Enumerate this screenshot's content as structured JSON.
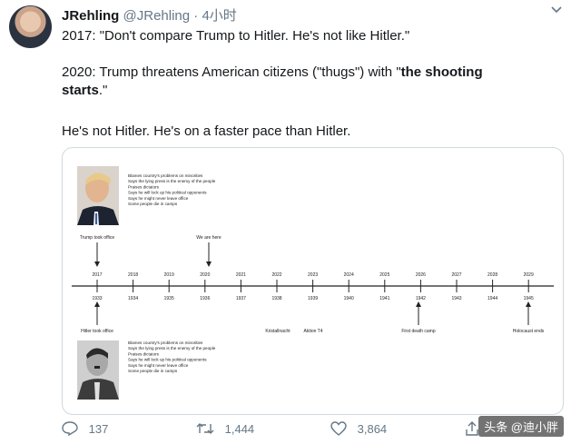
{
  "author": {
    "display_name": "JRehling",
    "handle": "@JRehling",
    "separator": "·",
    "time": "4小时"
  },
  "tweet": {
    "line1": "2017: \"Don't compare Trump to Hitler. He's not like Hitler.\"",
    "line2_prefix": "2020: Trump threatens American citizens (\"thugs\") with \"",
    "line2_bold_a": "the shooting",
    "line2_bold_b": "starts",
    "line2_suffix": ".\"",
    "line3": "He's not Hitler. He's on a faster pace than Hitler."
  },
  "timeline": {
    "top_years": [
      "2017",
      "2018",
      "2019",
      "2020",
      "2021",
      "2022",
      "2023",
      "2024",
      "2025",
      "2026",
      "2027",
      "2028",
      "2029"
    ],
    "bottom_years": [
      "1933",
      "1934",
      "1935",
      "1936",
      "1937",
      "1938",
      "1939",
      "1940",
      "1941",
      "1942",
      "1943",
      "1944",
      "1945"
    ],
    "top_list": [
      "Blames country's problems on minorities",
      "Says the lying press is the enemy of the people",
      "Praises dictators",
      "Says he will lock up his political opponents",
      "Says he might never leave office",
      "Some people die in camps"
    ],
    "bottom_list": [
      "Blames country's problems on minorities",
      "Says the lying press is the enemy of the people",
      "Praises dictators",
      "Says he will lock up his political opponents",
      "Says he might never leave office",
      "Some people die in camps"
    ],
    "trump_label": "Trump took office",
    "here_label": "We are here",
    "hitler_label": "Hitler took office",
    "kristallnacht": "Kristallnacht",
    "aktion": "Aktion T4",
    "first_death_camp": "First death camp",
    "holocaust_ends": "Holocaust ends"
  },
  "actions": {
    "replies": "137",
    "retweets": "1,444",
    "likes": "3,864"
  },
  "watermark": "头条 @迪小胖"
}
